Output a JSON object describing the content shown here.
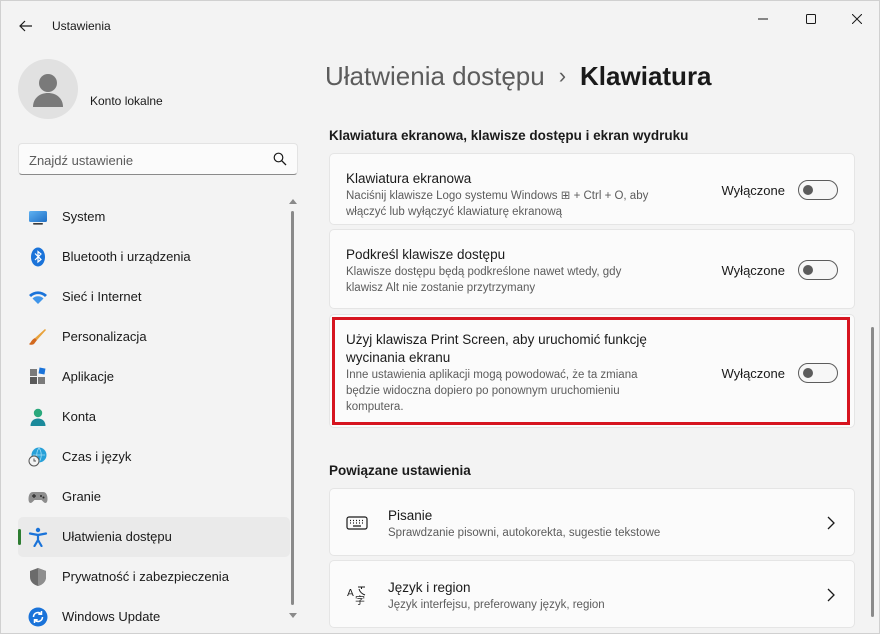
{
  "window": {
    "title": "Ustawienia"
  },
  "account": {
    "name": "Konto lokalne"
  },
  "search": {
    "placeholder": "Znajdź ustawienie"
  },
  "sidebar": {
    "items": [
      {
        "label": "System",
        "icon": "monitor-icon"
      },
      {
        "label": "Bluetooth i urządzenia",
        "icon": "bluetooth-icon"
      },
      {
        "label": "Sieć i Internet",
        "icon": "wifi-icon"
      },
      {
        "label": "Personalizacja",
        "icon": "brush-icon"
      },
      {
        "label": "Aplikacje",
        "icon": "apps-icon"
      },
      {
        "label": "Konta",
        "icon": "person-icon"
      },
      {
        "label": "Czas i język",
        "icon": "clock-globe-icon"
      },
      {
        "label": "Granie",
        "icon": "gamepad-icon"
      },
      {
        "label": "Ułatwienia dostępu",
        "icon": "accessibility-icon",
        "active": true
      },
      {
        "label": "Prywatność i zabezpieczenia",
        "icon": "shield-icon"
      },
      {
        "label": "Windows Update",
        "icon": "update-icon"
      }
    ]
  },
  "breadcrumb": {
    "parent": "Ułatwienia dostępu",
    "separator": "›",
    "current": "Klawiatura"
  },
  "sections": {
    "keyboard": "Klawiatura ekranowa, klawisze dostępu i ekran wydruku",
    "related": "Powiązane ustawienia"
  },
  "settings": [
    {
      "title": "Klawiatura ekranowa",
      "desc_lines": [
        "Naciśnij klawisze Logo systemu Windows ⊞ + Ctrl + O, aby",
        "włączyć lub wyłączyć klawiaturę ekranową"
      ],
      "state_label": "Wyłączone"
    },
    {
      "title": "Podkreśl klawisze dostępu",
      "desc_lines": [
        "Klawisze dostępu będą podkreślone nawet wtedy, gdy",
        "klawisz Alt nie zostanie przytrzymany"
      ],
      "state_label": "Wyłączone"
    },
    {
      "title_lines": [
        "Użyj klawisza Print Screen, aby uruchomić funkcję",
        "wycinania ekranu"
      ],
      "desc_lines": [
        "Inne ustawienia aplikacji mogą powodować, że ta zmiana",
        "będzie widoczna dopiero po ponownym uruchomieniu",
        "komputera."
      ],
      "state_label": "Wyłączone"
    }
  ],
  "related": [
    {
      "title": "Pisanie",
      "desc": "Sprawdzanie pisowni, autokorekta, sugestie tekstowe",
      "icon": "keyboard-icon"
    },
    {
      "title": "Język i region",
      "desc": "Język interfejsu, preferowany język, region",
      "icon": "language-icon"
    }
  ],
  "colors": {
    "highlight": "#d6141f",
    "active_bar": "#2e7d32",
    "accent": "#0067c0"
  }
}
